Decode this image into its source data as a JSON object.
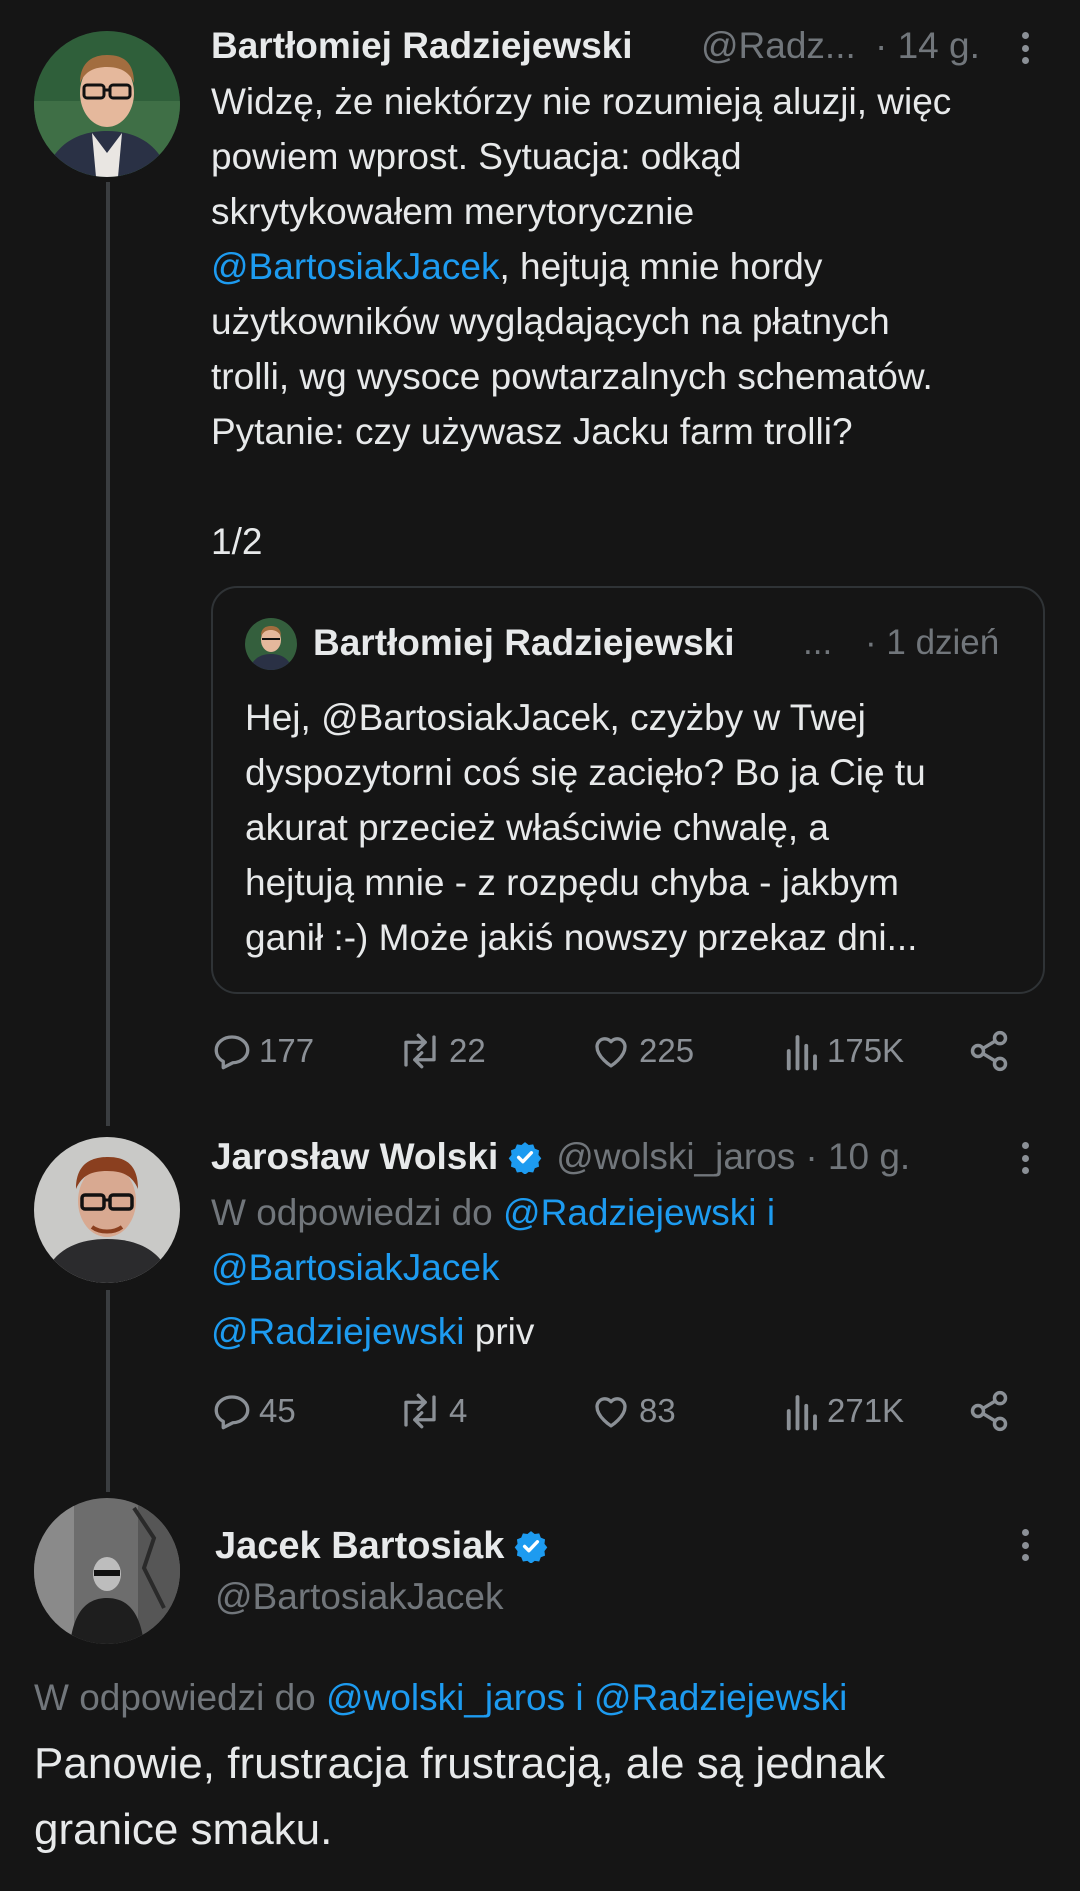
{
  "tweet1": {
    "name": "Bartłomiej Radziejewski",
    "handle": "@Radz...",
    "time": "· 14 g.",
    "lines": [
      [
        {
          "t": "Widzę, że niektórzy nie rozumieją aluzji, więc",
          "link": false
        }
      ],
      [
        {
          "t": "powiem wprost. Sytuacja: odkąd",
          "link": false
        }
      ],
      [
        {
          "t": "skrytykowałem merytorycznie",
          "link": false
        }
      ],
      [
        {
          "t": "@BartosiakJacek",
          "link": true
        },
        {
          "t": ", hejtują mnie hordy",
          "link": false
        }
      ],
      [
        {
          "t": "użytkowników wyglądających na płatnych",
          "link": false
        }
      ],
      [
        {
          "t": "trolli, wg wysoce powtarzalnych schematów.",
          "link": false
        }
      ],
      [
        {
          "t": "Pytanie: czy używasz Jacku farm trolli?",
          "link": false
        }
      ],
      [],
      [
        {
          "t": "1/2",
          "link": false
        }
      ]
    ],
    "quote": {
      "name": "Bartłomiej Radziejewski",
      "ellipsis": "...",
      "time": "· 1 dzień",
      "lines": [
        "Hej, @BartosiakJacek, czyżby w Twej",
        "dyspozytorni coś się zacięło? Bo ja Cię tu",
        "akurat przecież właściwie chwalę, a",
        "hejtują mnie - z rozpędu chyba - jakbym",
        "ganił :-) Może jakiś nowszy przekaz dni..."
      ]
    },
    "stats": {
      "replies": "177",
      "reposts": "22",
      "likes": "225",
      "views": "175K"
    }
  },
  "tweet2": {
    "name": "Jarosław Wolski",
    "handle": "@wolski_jaros",
    "time": "· 10 g.",
    "reply_prefix": "W odpowiedzi do",
    "reply_user1": "@Radziejewski",
    "reply_and": "i",
    "reply_user2": "@BartosiakJacek",
    "body_mention": "@Radziejewski",
    "body_text": " priv",
    "stats": {
      "replies": "45",
      "reposts": "4",
      "likes": "83",
      "views": "271K"
    }
  },
  "tweet3": {
    "name": "Jacek Bartosiak",
    "handle": "@BartosiakJacek",
    "reply_prefix": "W odpowiedzi do",
    "reply_user1": "@wolski_jaros",
    "reply_and": "i",
    "reply_user2": "@Radziejewski",
    "lines": [
      "Panowie, frustracja frustracją, ale są jednak",
      "granice smaku."
    ]
  },
  "colors": {
    "background": "#151515",
    "accent": "#1d9bf0",
    "muted": "#71767b",
    "text": "#e7e9ea",
    "verified": "#1d9bf0"
  },
  "icons": [
    "more-icon",
    "reply-icon",
    "repost-icon",
    "like-icon",
    "views-icon",
    "share-icon",
    "verified-icon"
  ]
}
